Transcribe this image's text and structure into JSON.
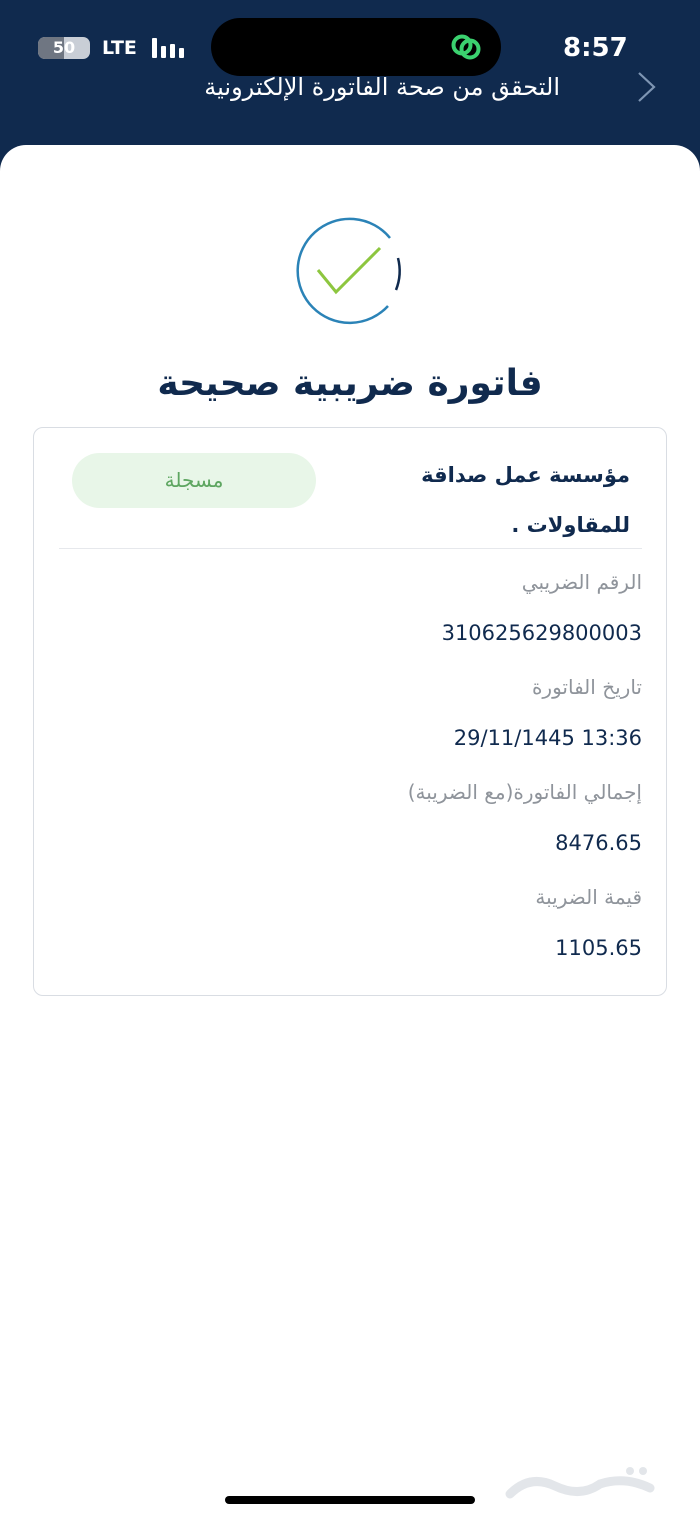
{
  "status_bar": {
    "time": "8:57",
    "battery_percent": "50",
    "battery_level": 0.5,
    "network": "LTE"
  },
  "header": {
    "title": "التحقق من صحة الفاتورة الإلكترونية",
    "back_icon": "chevron-right-icon",
    "background_color": "#102a4e"
  },
  "result": {
    "icon": "check-circle-icon",
    "title": "فاتورة ضريبية صحيحة"
  },
  "invoice": {
    "company_name_line1": "مؤسسة عمل صداقة",
    "company_name_line2": "للمقاولات .",
    "status": "مسجلة",
    "fields": [
      {
        "label": "الرقم الضريبي",
        "value": "310625629800003"
      },
      {
        "label": "تاريخ الفاتورة",
        "value": "29/11/1445 13:36"
      },
      {
        "label": "إجمالي الفاتورة(مع الضريبة)",
        "value": "8476.65"
      },
      {
        "label": "قيمة الضريبة",
        "value": "1105.65"
      }
    ]
  },
  "watermark": "haraj-logo",
  "colors": {
    "primary": "#102a4e",
    "success": "#5ea661",
    "success_bg": "#e8f6e8"
  }
}
